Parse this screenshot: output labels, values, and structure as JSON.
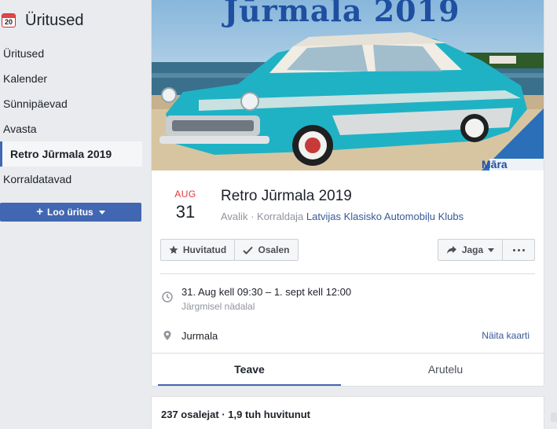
{
  "sidebar": {
    "header_icon_day": "20",
    "title": "Üritused",
    "items": [
      {
        "label": "Üritused"
      },
      {
        "label": "Kalender"
      },
      {
        "label": "Sünnipäevad"
      },
      {
        "label": "Avasta"
      },
      {
        "label": "Retro Jūrmala 2019"
      },
      {
        "label": "Korraldatavad"
      }
    ],
    "active_item": "Retro Jūrmala 2019",
    "create_button": {
      "label": "Loo üritus"
    }
  },
  "cover": {
    "headline": "Jūrmala 2019",
    "corner_text": "Māra"
  },
  "event": {
    "month": "AUG",
    "day": "31",
    "title": "Retro Jūrmala 2019",
    "privacy": "Avalik",
    "host_prefix": "Korraldaja",
    "host": "Latvijas Klasisko Automobiļu Klubs"
  },
  "actions": {
    "interested": "Huvitatud",
    "going": "Osalen",
    "share": "Jaga"
  },
  "details": {
    "datetime": "31. Aug kell 09:30 – 1. sept kell 12:00",
    "relative": "Järgmisel nädalal",
    "location": "Jurmala",
    "map_link": "Näita kaarti"
  },
  "tabs": [
    {
      "label": "Teave",
      "active": true
    },
    {
      "label": "Arutelu",
      "active": false
    }
  ],
  "stats": {
    "summary": "237 osalejat · 1,9 tuh huvitunut"
  },
  "colors": {
    "brand": "#4267b2",
    "link": "#385898",
    "date_month": "#e0393e",
    "cover_title": "#1f4fa0",
    "car_body": "#1fb2c4"
  }
}
